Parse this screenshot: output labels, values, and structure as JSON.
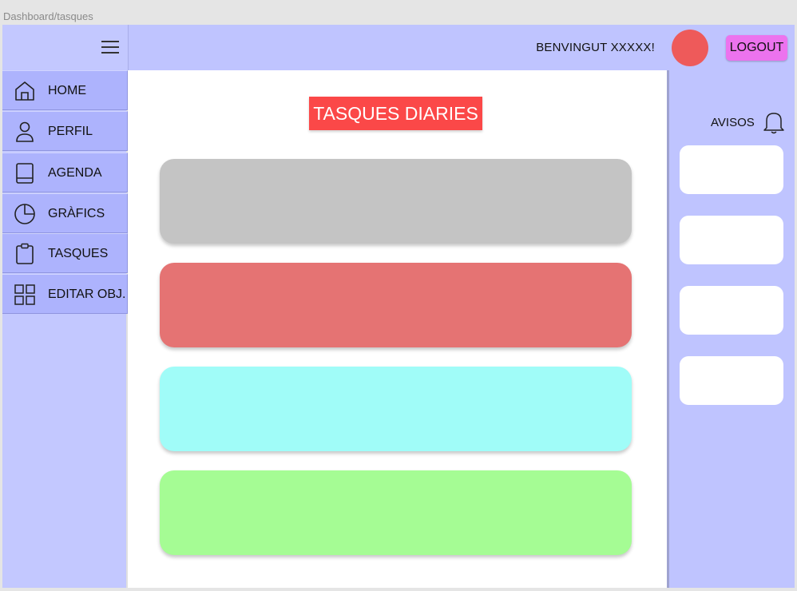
{
  "frame": {
    "label": "Dashboard/tasques"
  },
  "header": {
    "welcome": "BENVINGUT XXXXX!",
    "logout_label": "LOGOUT",
    "avatar_color": "#ee5a5a",
    "accent": "#bfc4ff"
  },
  "sidebar": {
    "items": [
      {
        "label": "HOME",
        "icon": "home-icon"
      },
      {
        "label": "PERFIL",
        "icon": "user-icon"
      },
      {
        "label": "AGENDA",
        "icon": "book-icon"
      },
      {
        "label": "GRÀFICS",
        "icon": "pie-chart-icon"
      },
      {
        "label": "TASQUES",
        "icon": "clipboard-icon"
      },
      {
        "label": "EDITAR OBJ.",
        "icon": "grid-icon"
      }
    ],
    "settings_icon": "gear-icon"
  },
  "main": {
    "title": "TASQUES DIARIES",
    "tasks": [
      {
        "color": "#c4c4c4"
      },
      {
        "color": "#e57373"
      },
      {
        "color": "#a0fcf8"
      },
      {
        "color": "#a5fc94"
      }
    ]
  },
  "notices": {
    "label": "AVISOS",
    "icon": "bell-icon",
    "count": 4
  }
}
